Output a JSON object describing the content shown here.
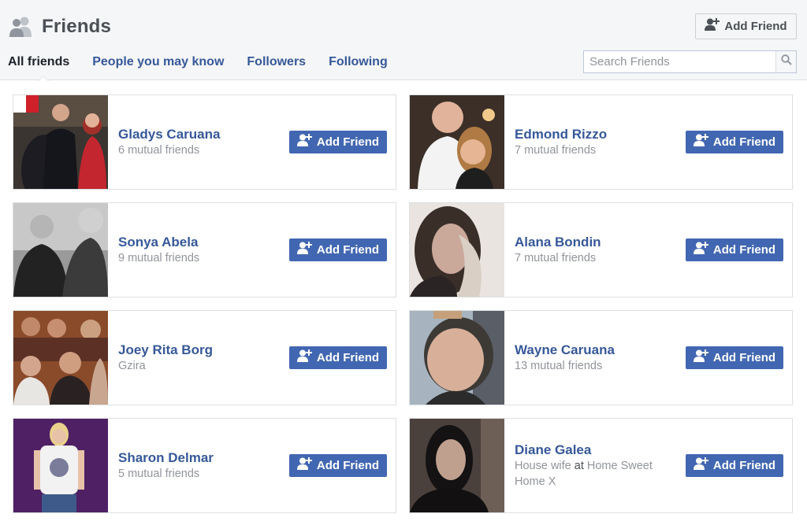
{
  "header": {
    "title": "Friends",
    "add_friend_label": "Add Friend"
  },
  "tabs": [
    {
      "label": "All friends",
      "active": true
    },
    {
      "label": "People you may know",
      "active": false
    },
    {
      "label": "Followers",
      "active": false
    },
    {
      "label": "Following",
      "active": false
    }
  ],
  "search": {
    "placeholder": "Search Friends",
    "value": ""
  },
  "cards": [
    {
      "name": "Gladys Caruana",
      "subtitle": "6 mutual friends",
      "button_label": "Add Friend"
    },
    {
      "name": "Edmond Rizzo",
      "subtitle": "7 mutual friends",
      "button_label": "Add Friend"
    },
    {
      "name": "Sonya Abela",
      "subtitle": "9 mutual friends",
      "button_label": "Add Friend"
    },
    {
      "name": "Alana Bondin",
      "subtitle": "7 mutual friends",
      "button_label": "Add Friend"
    },
    {
      "name": "Joey Rita Borg",
      "subtitle": "Gzira",
      "button_label": "Add Friend"
    },
    {
      "name": "Wayne Caruana",
      "subtitle": "13 mutual friends",
      "button_label": "Add Friend"
    },
    {
      "name": "Sharon Delmar",
      "subtitle": "5 mutual friends",
      "button_label": "Add Friend"
    },
    {
      "name": "Diane Galea",
      "subtitle_pre": "House wife",
      "subtitle_mid": "at",
      "subtitle_post": "Home Sweet Home X",
      "button_label": "Add Friend"
    }
  ],
  "colors": {
    "brand_blue": "#4267b2",
    "link_blue": "#365899",
    "muted": "#90949c",
    "header_bg": "#f5f6f7"
  },
  "icons": [
    "friends-icon",
    "add-friend-icon",
    "search-icon"
  ]
}
